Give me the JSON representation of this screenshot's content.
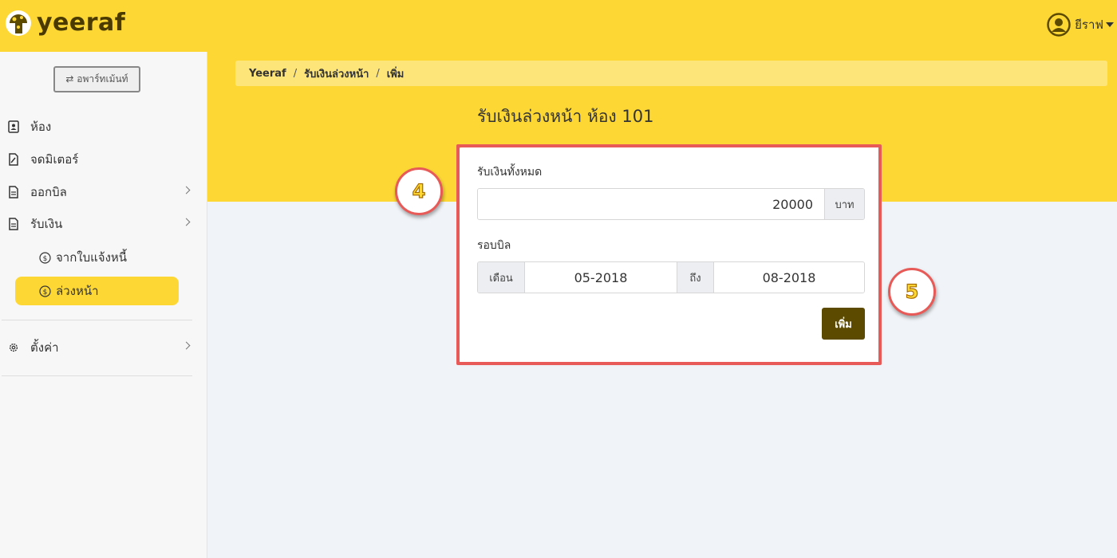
{
  "app": {
    "name": "yeeraf"
  },
  "user": {
    "name": "ยีราฟ"
  },
  "sidebar": {
    "apartment_button": "⇄ อพาร์ทเม้นท์",
    "items": [
      {
        "label": "ห้อง",
        "icon": "contact-card-icon"
      },
      {
        "label": "จดมิเตอร์",
        "icon": "meter-file-icon"
      },
      {
        "label": "ออกบิล",
        "icon": "document-icon",
        "has_children": true
      },
      {
        "label": "รับเงิน",
        "icon": "document-icon",
        "has_children": true,
        "expanded": true,
        "children": [
          {
            "label": "จากใบแจ้งหนี้",
            "icon": "dollar-circle-icon"
          },
          {
            "label": "ล่วงหน้า",
            "icon": "dollar-circle-icon",
            "active": true
          }
        ]
      },
      {
        "label": "ตั้งค่า",
        "icon": "gear-icon",
        "has_children": true
      }
    ]
  },
  "breadcrumb": [
    "Yeeraf",
    "รับเงินล่วงหน้า",
    "เพิ่ม"
  ],
  "page": {
    "title": "รับเงินล่วงหน้า ห้อง 101"
  },
  "form": {
    "total_label": "รับเงินทั้งหมด",
    "total_value": "20000",
    "total_unit": "บาท",
    "period_label": "รอบบิล",
    "month_label": "เดือน",
    "month_from": "05-2018",
    "to_label": "ถึง",
    "month_to": "08-2018",
    "submit_label": "เพิ่ม"
  },
  "annotations": {
    "step1": "4",
    "step2": "5"
  },
  "colors": {
    "brand": "#fdd835",
    "button": "#5c4a00",
    "highlight": "#e75a57"
  }
}
